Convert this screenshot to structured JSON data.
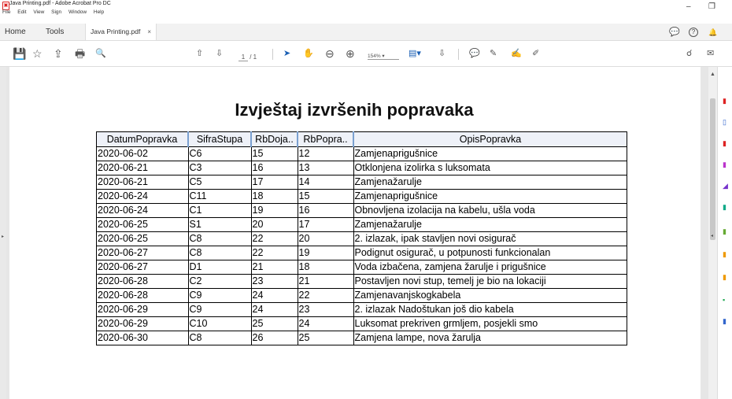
{
  "window": {
    "title": "Java Printing.pdf - Adobe Acrobat Pro DC",
    "minimize": "–",
    "restore": "❐"
  },
  "menu": [
    "File",
    "Edit",
    "View",
    "Sign",
    "Window",
    "Help"
  ],
  "tabs": {
    "home": "Home",
    "tools": "Tools",
    "doc": "Java Printing.pdf",
    "close": "×"
  },
  "toolbar": {
    "page_current": "1",
    "page_total": "/ 1",
    "zoom": "154%"
  },
  "document": {
    "title": "Izvještaj izvršenih popravaka",
    "columns": [
      "DatumPopravka",
      "SifraStupa",
      "RbDoja..",
      "RbPopra..",
      "OpisPopravka"
    ],
    "rows": [
      [
        "2020-06-02",
        "C6",
        "15",
        "12",
        "Zamjenaprigušnice"
      ],
      [
        "2020-06-21",
        "C3",
        "16",
        "13",
        "Otklonjena izolirka s luksomata"
      ],
      [
        "2020-06-21",
        "C5",
        "17",
        "14",
        "Zamjenažarulje"
      ],
      [
        "2020-06-24",
        "C11",
        "18",
        "15",
        "Zamjenaprigušnice"
      ],
      [
        "2020-06-24",
        "C1",
        "19",
        "16",
        "Obnovljena izolacija na kabelu, ušla voda"
      ],
      [
        "2020-06-25",
        "S1",
        "20",
        "17",
        "Zamjenažarulje"
      ],
      [
        "2020-06-25",
        "C8",
        "22",
        "20",
        "2. izlazak, ipak stavljen novi osigurač"
      ],
      [
        "2020-06-27",
        "C8",
        "22",
        "19",
        "Podignut osigurač, u potpunosti funkcionalan"
      ],
      [
        "2020-06-27",
        "D1",
        "21",
        "18",
        "Voda izbačena, zamjena žarulje i prigušnice"
      ],
      [
        "2020-06-28",
        "C2",
        "23",
        "21",
        "Postavljen novi stup, temelj je bio na lokaciji"
      ],
      [
        "2020-06-28",
        "C9",
        "24",
        "22",
        "Zamjenavanjskogkabela"
      ],
      [
        "2020-06-29",
        "C9",
        "24",
        "23",
        "2. izlazak Nadoštukan još dio kabela"
      ],
      [
        "2020-06-29",
        "C10",
        "25",
        "24",
        "Luksomat prekriven grmljem, posjekli smo"
      ],
      [
        "2020-06-30",
        "C8",
        "26",
        "25",
        "Zamjena lampe, nova žarulja"
      ]
    ]
  },
  "icons": {
    "save": "💾",
    "bookmark": "☆",
    "upload": "⇪",
    "print": "🖶",
    "search": "🔍",
    "prev_page": "⇧",
    "next_page": "⇩",
    "select": "➤",
    "hand": "✋",
    "zoom_out": "⊖",
    "zoom_in": "⊕",
    "comment": "💬",
    "highlight": "✎",
    "sign": "✍",
    "share": "☌",
    "mail": "✉",
    "help": "?",
    "bell": "🔔",
    "chat": "💬"
  },
  "colors": {
    "accent_red": "#dd2222",
    "table_header_bg": "#eef1f8"
  }
}
